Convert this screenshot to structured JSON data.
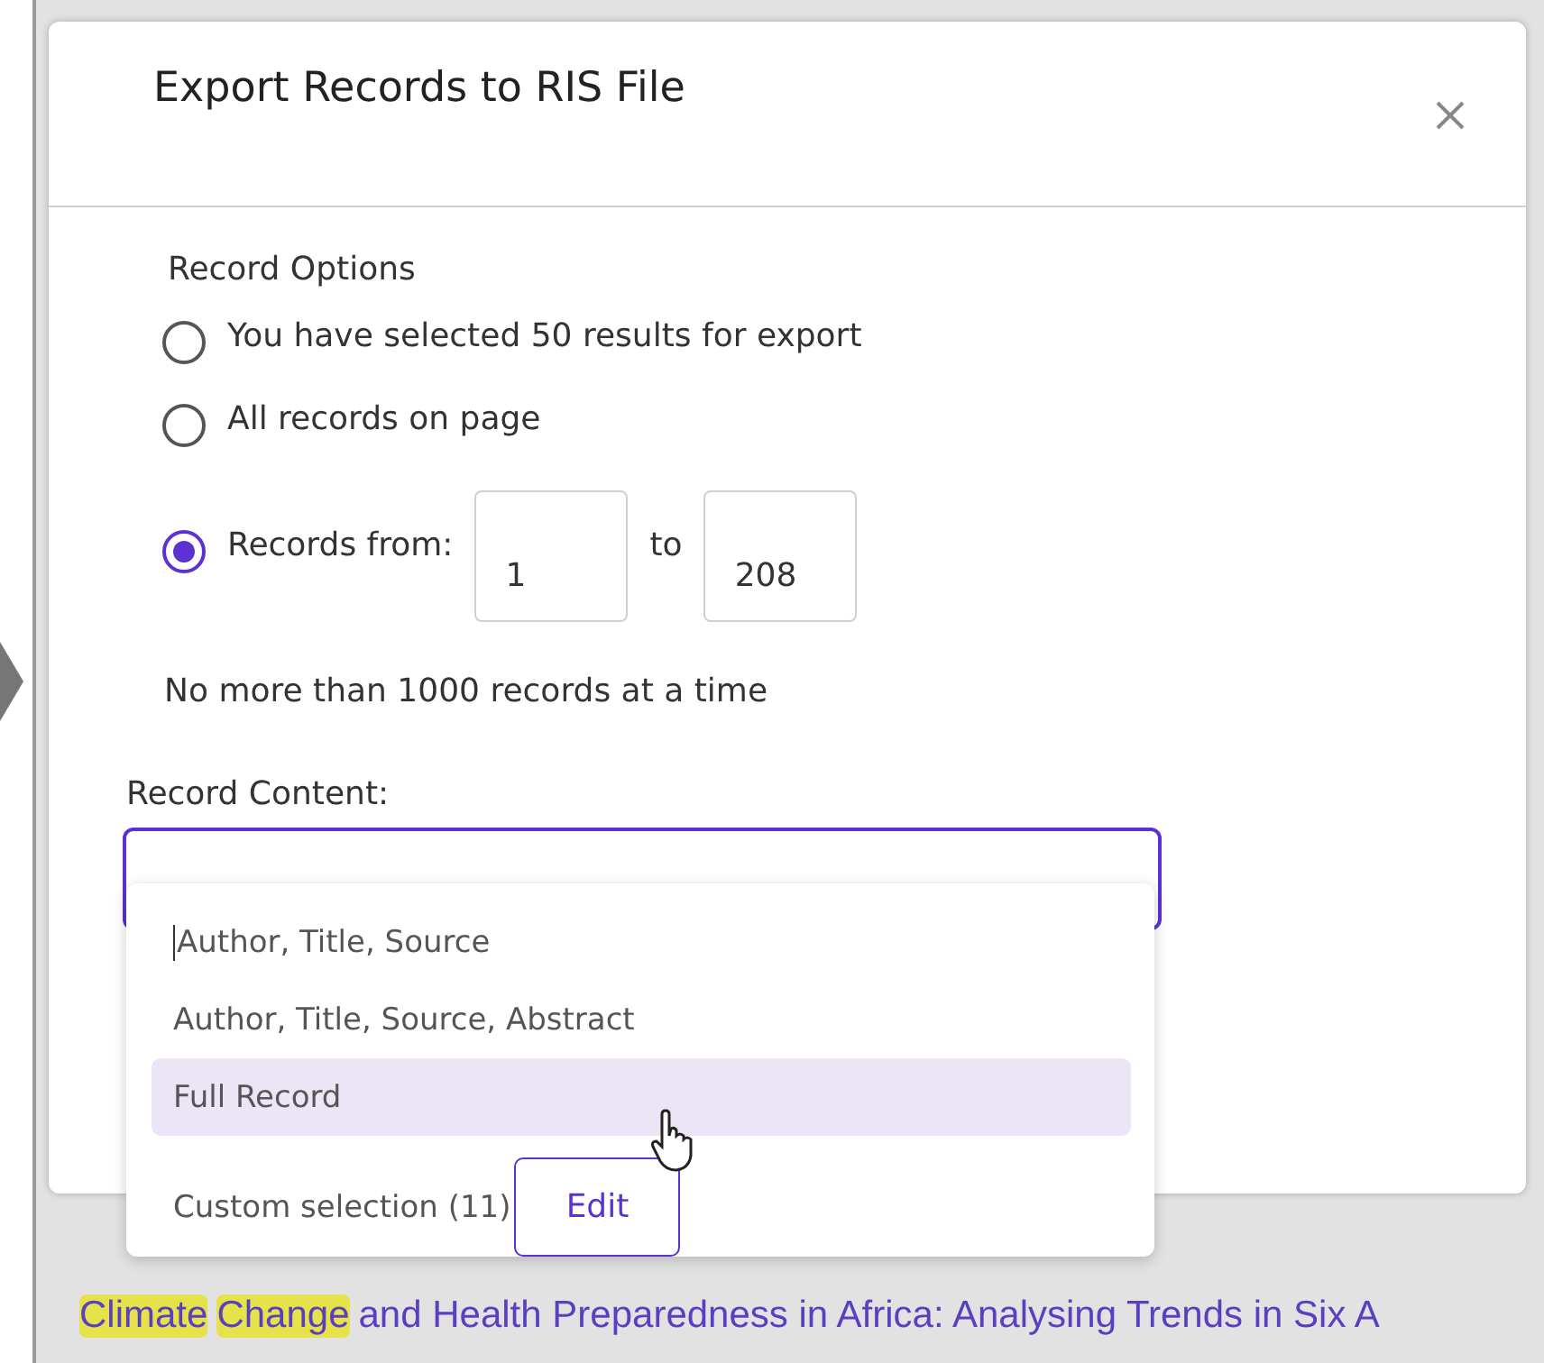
{
  "background": {
    "title_parts": [
      {
        "text": "Climate",
        "highlighted": true
      },
      {
        "text": "Change",
        "highlighted": true
      },
      {
        "text": "and Health Preparedness in Africa: Analysing Trends in Six A",
        "highlighted": false
      }
    ]
  },
  "dialog": {
    "title": "Export Records to RIS File",
    "record_options": {
      "label": "Record Options",
      "options": [
        {
          "kind": "plain",
          "label": "You have selected 50 results for export",
          "selected": false
        },
        {
          "kind": "plain",
          "label": "All records on page",
          "selected": false
        },
        {
          "kind": "range",
          "label": "Records from:",
          "selected": true,
          "from": "1",
          "to_label": "to",
          "to": "208"
        }
      ]
    },
    "note": "No more than 1000 records at a time",
    "record_content": {
      "label": "Record Content:",
      "options": [
        {
          "label": "Author, Title, Source",
          "hovered": false
        },
        {
          "label": "Author, Title, Source, Abstract",
          "hovered": false
        },
        {
          "label": "Full Record",
          "hovered": true
        }
      ],
      "custom": {
        "label": "Custom selection (11)",
        "button": "Edit"
      }
    }
  }
}
